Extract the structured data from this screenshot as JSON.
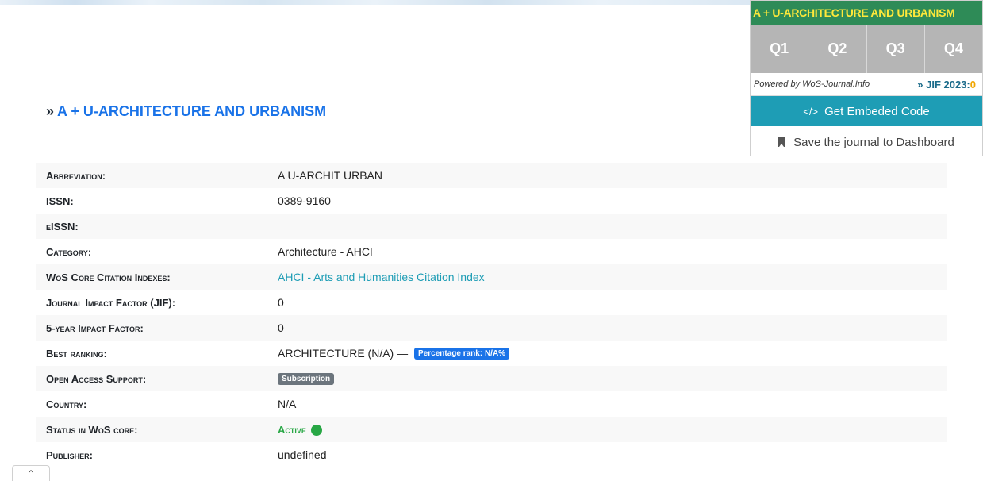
{
  "journal": {
    "title_prefix": "»",
    "title": "A + U-ARCHITECTURE AND URBANISM"
  },
  "widget": {
    "header": "A + U-ARCHITECTURE AND URBANISM",
    "quartiles": [
      "Q1",
      "Q2",
      "Q3",
      "Q4"
    ],
    "powered_by": "Powered by WoS-Journal.Info",
    "jif_label": "» JIF 2023:",
    "jif_value": "0",
    "embed_label": "Get Embeded Code",
    "embed_icon": "code-icon",
    "save_label": "Save the journal to Dashboard",
    "save_icon": "bookmark-icon",
    "header_bg": "#2e8b57",
    "header_text_color": "#ffe83a",
    "embed_bg": "#1e9db5"
  },
  "table": {
    "rows": [
      {
        "label": "Abbreviation:",
        "value": "A U-ARCHIT URBAN"
      },
      {
        "label": "ISSN:",
        "value": "0389-9160"
      },
      {
        "label": "eISSN:",
        "value": ""
      },
      {
        "label": "Category:",
        "value": "Architecture - AHCI"
      },
      {
        "label": "WoS Core Citation Indexes:",
        "value": "AHCI - Arts and Humanities Citation Index"
      },
      {
        "label": "Journal Impact Factor (JIF):",
        "value": "0"
      },
      {
        "label": "5-year Impact Factor:",
        "value": "0"
      },
      {
        "label": "Best ranking:",
        "value": "ARCHITECTURE (N/A) —",
        "badge": "Percentage rank: N/A%"
      },
      {
        "label": "Open Access Support:",
        "badge": "Subscription"
      },
      {
        "label": "Country:",
        "value": "N/A"
      },
      {
        "label": "Status in WoS core:",
        "value": "Active"
      },
      {
        "label": "Publisher:",
        "value": "undefined"
      }
    ]
  },
  "scroll_top_icon": "chevron-up-icon"
}
